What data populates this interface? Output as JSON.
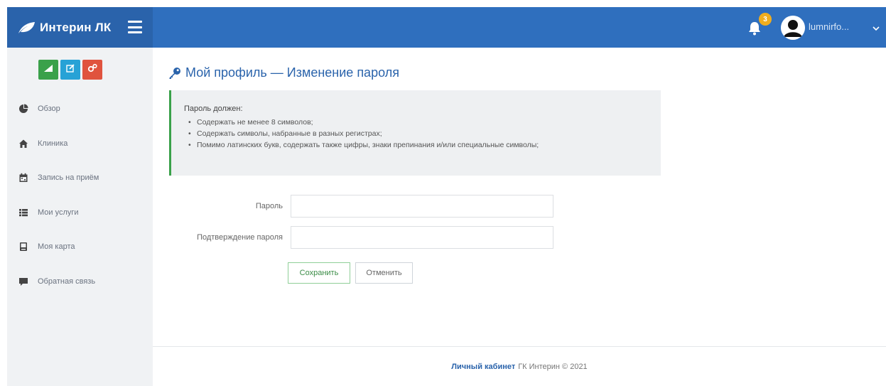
{
  "header": {
    "brand_title": "Интерин ЛК",
    "notification_count": "3",
    "username": "lumnirfo...",
    "colors": {
      "header": "#2f6fbe",
      "brand": "#2a63ab",
      "badge": "#f0ad1e"
    }
  },
  "sidebar": {
    "quick_actions": [
      {
        "icon": "chart-icon",
        "color": "#3aa14a"
      },
      {
        "icon": "edit-icon",
        "color": "#27a2d6"
      },
      {
        "icon": "cogs-icon",
        "color": "#e0533e"
      }
    ],
    "items": [
      {
        "label": "Обзор",
        "icon": "pie-chart-icon"
      },
      {
        "label": "Клиника",
        "icon": "home-icon"
      },
      {
        "label": "Запись на приём",
        "icon": "calendar-icon"
      },
      {
        "label": "Мои услуги",
        "icon": "list-icon"
      },
      {
        "label": "Моя карта",
        "icon": "card-icon"
      },
      {
        "label": "Обратная связь",
        "icon": "comment-icon"
      }
    ]
  },
  "main": {
    "page_title": "Мой профиль — Изменение пароля",
    "requirements": {
      "lead": "Пароль должен:",
      "items": [
        "Содержать не менее 8 символов;",
        "Содержать символы, набранные в разных регистрах;",
        "Помимо латинских букв, содержать также цифры, знаки препинания и/или специальные символы;"
      ]
    },
    "form": {
      "password_label": "Пароль",
      "password_value": "",
      "confirm_label": "Подтверждение пароля",
      "confirm_value": "",
      "save_label": "Сохранить",
      "cancel_label": "Отменить"
    }
  },
  "footer": {
    "link_text": "Личный кабинет",
    "text": "ГК Интерин © 2021"
  }
}
